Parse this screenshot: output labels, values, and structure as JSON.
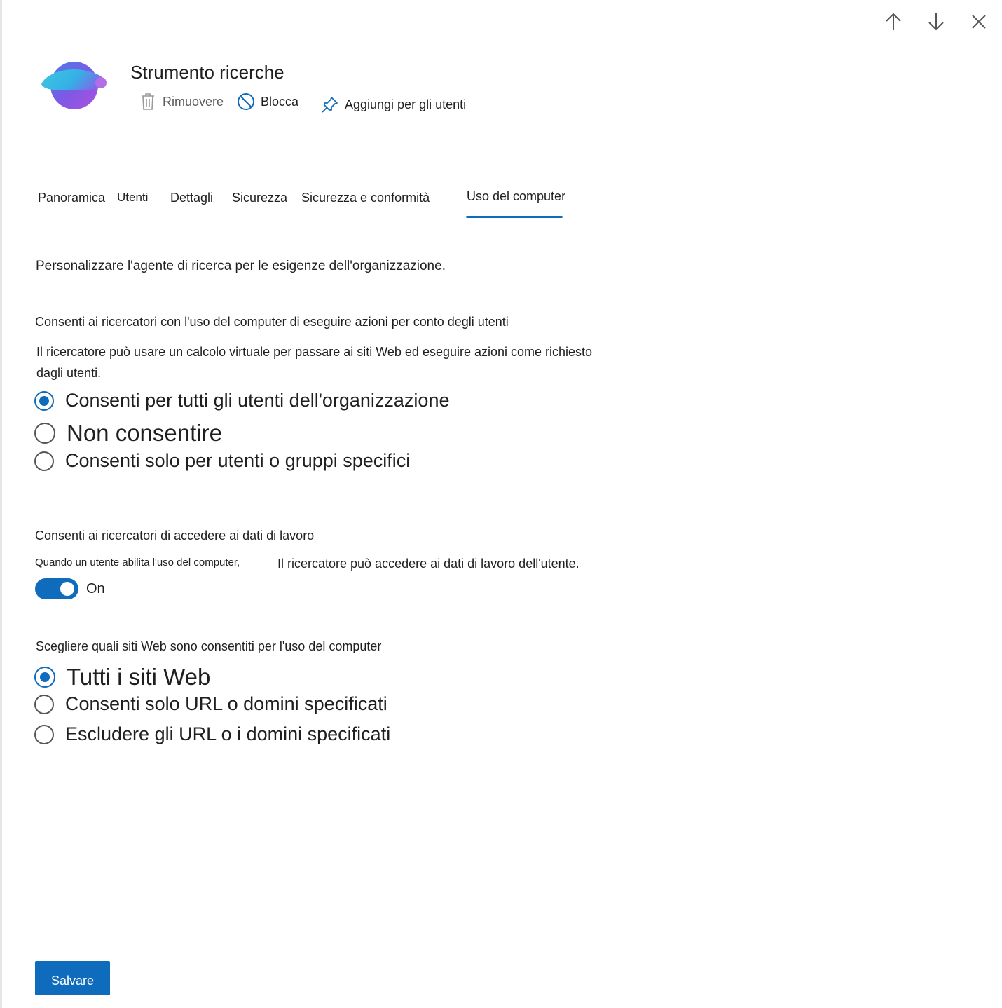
{
  "window_controls": {
    "prev": "arrow-up-icon",
    "next": "arrow-down-icon",
    "close": "close-icon"
  },
  "app": {
    "title": "Strumento ricerche",
    "actions": [
      {
        "label": "Rimuovere",
        "icon": "trash-icon",
        "enabled": false
      },
      {
        "label": "Blocca",
        "icon": "block-icon",
        "enabled": true
      },
      {
        "label": "Aggiungi per gli utenti",
        "icon": "pin-icon",
        "enabled": true
      }
    ]
  },
  "tabs": [
    {
      "label": "Panoramica"
    },
    {
      "label": "Utenti"
    },
    {
      "label": "Dettagli"
    },
    {
      "label": "Sicurezza"
    },
    {
      "label": "Sicurezza e conformità"
    },
    {
      "label": "Uso del computer",
      "selected": true
    }
  ],
  "intro": "Personalizzare l'agente di ricerca per le esigenze dell'organizzazione.",
  "computer_use": {
    "heading": "Consenti ai ricercatori con l'uso del computer di eseguire azioni per conto degli utenti",
    "description_line1": "Il ricercatore può usare un calcolo virtuale per passare ai siti Web ed eseguire azioni come richiesto",
    "description_line2": "dagli utenti.",
    "options": [
      {
        "label": "Consenti per tutti gli utenti dell'organizzazione",
        "checked": true
      },
      {
        "label": "Non consentire",
        "checked": false
      },
      {
        "label": "Consenti solo per utenti o gruppi specifici",
        "checked": false
      }
    ]
  },
  "work_data": {
    "heading": "Consenti ai ricercatori di accedere ai dati di lavoro",
    "description_part1": "Quando un utente abilita l'uso del computer,",
    "description_part2": "Il ricercatore può accedere ai dati di lavoro dell'utente.",
    "toggle_on": true,
    "toggle_label": "On"
  },
  "websites": {
    "heading": "Scegliere quali siti Web sono consentiti per l'uso del computer",
    "options": [
      {
        "label": "Tutti i siti Web",
        "checked": true
      },
      {
        "label": "Consenti solo URL o domini specificati",
        "checked": false
      },
      {
        "label": "Escludere gli URL o i domini specificati",
        "checked": false
      }
    ]
  },
  "save_label": "Salvare",
  "colors": {
    "accent": "#0f6cbd",
    "text": "#1f1f1f",
    "icon": "#555555"
  }
}
